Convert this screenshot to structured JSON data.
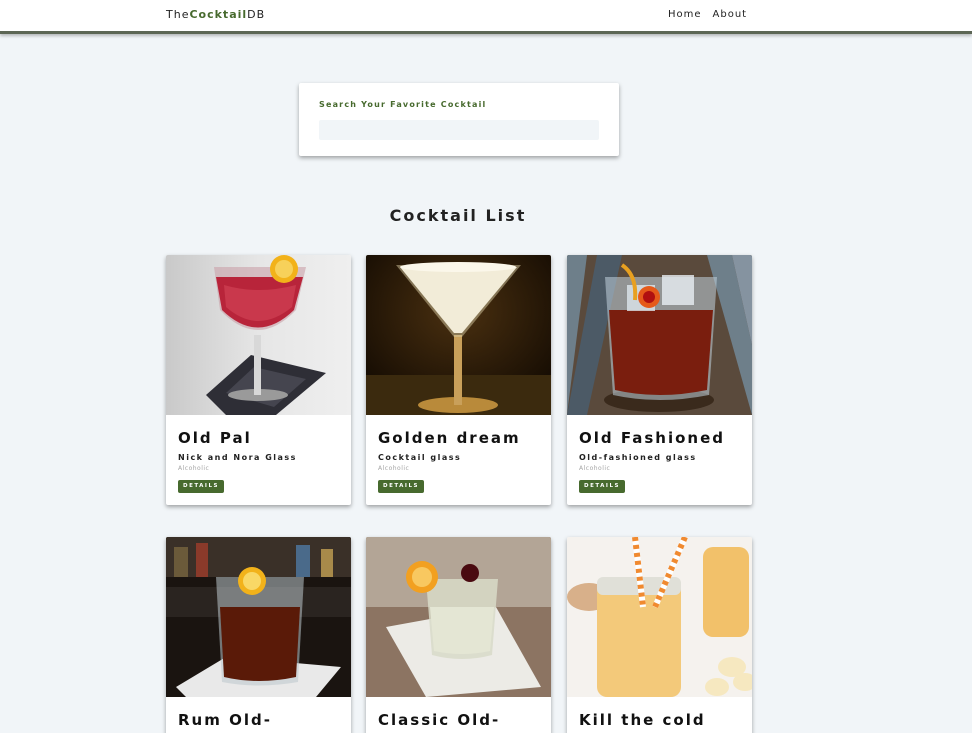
{
  "navbar": {
    "logo_prefix": "The",
    "logo_brand": "Cocktail",
    "logo_suffix": "DB",
    "links": [
      "Home",
      "About"
    ]
  },
  "search": {
    "label": "Search Your Favorite Cocktail",
    "value": "",
    "placeholder": ""
  },
  "section": {
    "title": "Cocktail List"
  },
  "cocktails": [
    {
      "name": "Old Pal",
      "glass": "Nick and Nora Glass",
      "info": "Alcoholic",
      "button": "DETAILS"
    },
    {
      "name": "Golden dream",
      "glass": "Cocktail glass",
      "info": "Alcoholic",
      "button": "DETAILS"
    },
    {
      "name": "Old Fashioned",
      "glass": "Old-fashioned glass",
      "info": "Alcoholic",
      "button": "DETAILS"
    },
    {
      "name": "Rum Old-"
    },
    {
      "name": "Classic Old-"
    },
    {
      "name": "Kill the cold"
    }
  ],
  "colors": {
    "accent": "#476a2e",
    "background": "#f1f5f8",
    "navbar_border": "#5c6655"
  }
}
